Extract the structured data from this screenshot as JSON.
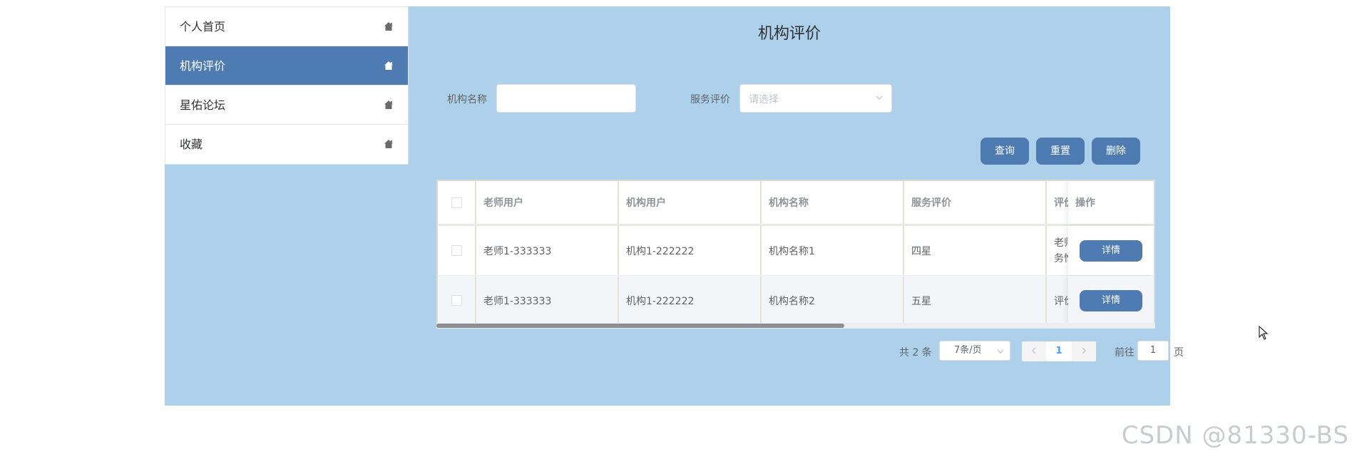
{
  "sidebar": {
    "items": [
      {
        "label": "个人首页",
        "icon": "home-icon",
        "active": false
      },
      {
        "label": "机构评价",
        "icon": "home-icon",
        "active": true
      },
      {
        "label": "星佑论坛",
        "icon": "home-icon",
        "active": false
      },
      {
        "label": "收藏",
        "icon": "home-icon",
        "active": false
      }
    ]
  },
  "page": {
    "title": "机构评价"
  },
  "search": {
    "org_name_label": "机构名称",
    "org_name_value": "",
    "service_rating_label": "服务评价",
    "service_rating_placeholder": "请选择"
  },
  "actions": {
    "query": "查询",
    "reset": "重置",
    "delete": "删除"
  },
  "table": {
    "headers": [
      "老师用户",
      "机构用户",
      "机构名称",
      "服务评价",
      "评价",
      "操作"
    ],
    "rows": [
      {
        "teacher": "老师1-333333",
        "org_user": "机构1-222222",
        "org_name": "机构名称1",
        "rating": "四星",
        "review": "老师\n务惟",
        "action": "详情"
      },
      {
        "teacher": "老师1-333333",
        "org_user": "机构1-222222",
        "org_name": "机构名称2",
        "rating": "五星",
        "review": "评价",
        "action": "详情"
      }
    ]
  },
  "pagination": {
    "total": "共 2 条",
    "page_size": "7条/页",
    "current_page": "1",
    "goto_label": "前往",
    "goto_value": "1",
    "page_suffix": "页"
  },
  "watermark": "CSDN @81330-BS",
  "colors": {
    "accent": "#4e7cb2",
    "background": "#add1ea"
  }
}
